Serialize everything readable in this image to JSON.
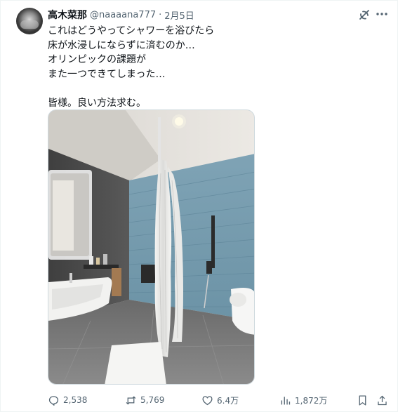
{
  "author": {
    "name": "高木菜那",
    "handle": "@naaaana777",
    "separator": "·",
    "date": "2月5日"
  },
  "tweet": {
    "lines": [
      "これはどうやってシャワーを浴びたら",
      "床が水浸しにならずに済むのか…",
      "オリンピックの課題が",
      "また一つできてしまった…",
      "",
      "皆様。良い方法求む。"
    ]
  },
  "media": {
    "icon": "bathroom-photo"
  },
  "actions": {
    "replies": "2,538",
    "reposts": "5,769",
    "likes": "6.4万",
    "views": "1,872万"
  },
  "icons": {
    "grok": "grok-icon",
    "more": "more-icon",
    "reply": "reply-icon",
    "repost": "repost-icon",
    "like": "heart-icon",
    "views": "views-icon",
    "bookmark": "bookmark-icon",
    "share": "share-icon"
  },
  "colors": {
    "text": "#0f1419",
    "muted": "#536471",
    "border": "#cfd9de"
  }
}
